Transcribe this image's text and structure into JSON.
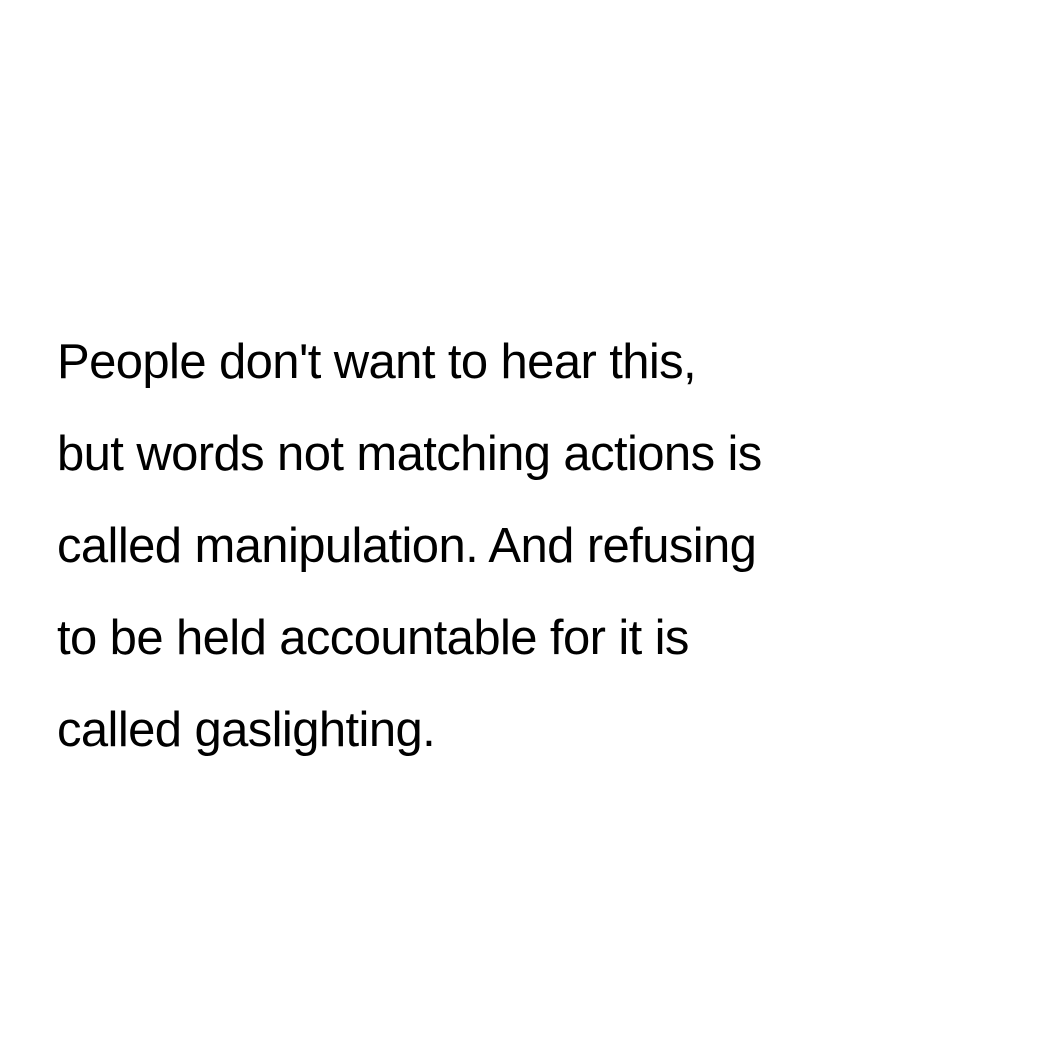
{
  "background_color": "#ffffff",
  "text_color": "#000000",
  "quote": {
    "lines": [
      "People don't want to hear this,",
      "but words not matching actions is",
      "called manipulation. And refusing",
      "to be held accountable for it is",
      "called gaslighting."
    ]
  }
}
